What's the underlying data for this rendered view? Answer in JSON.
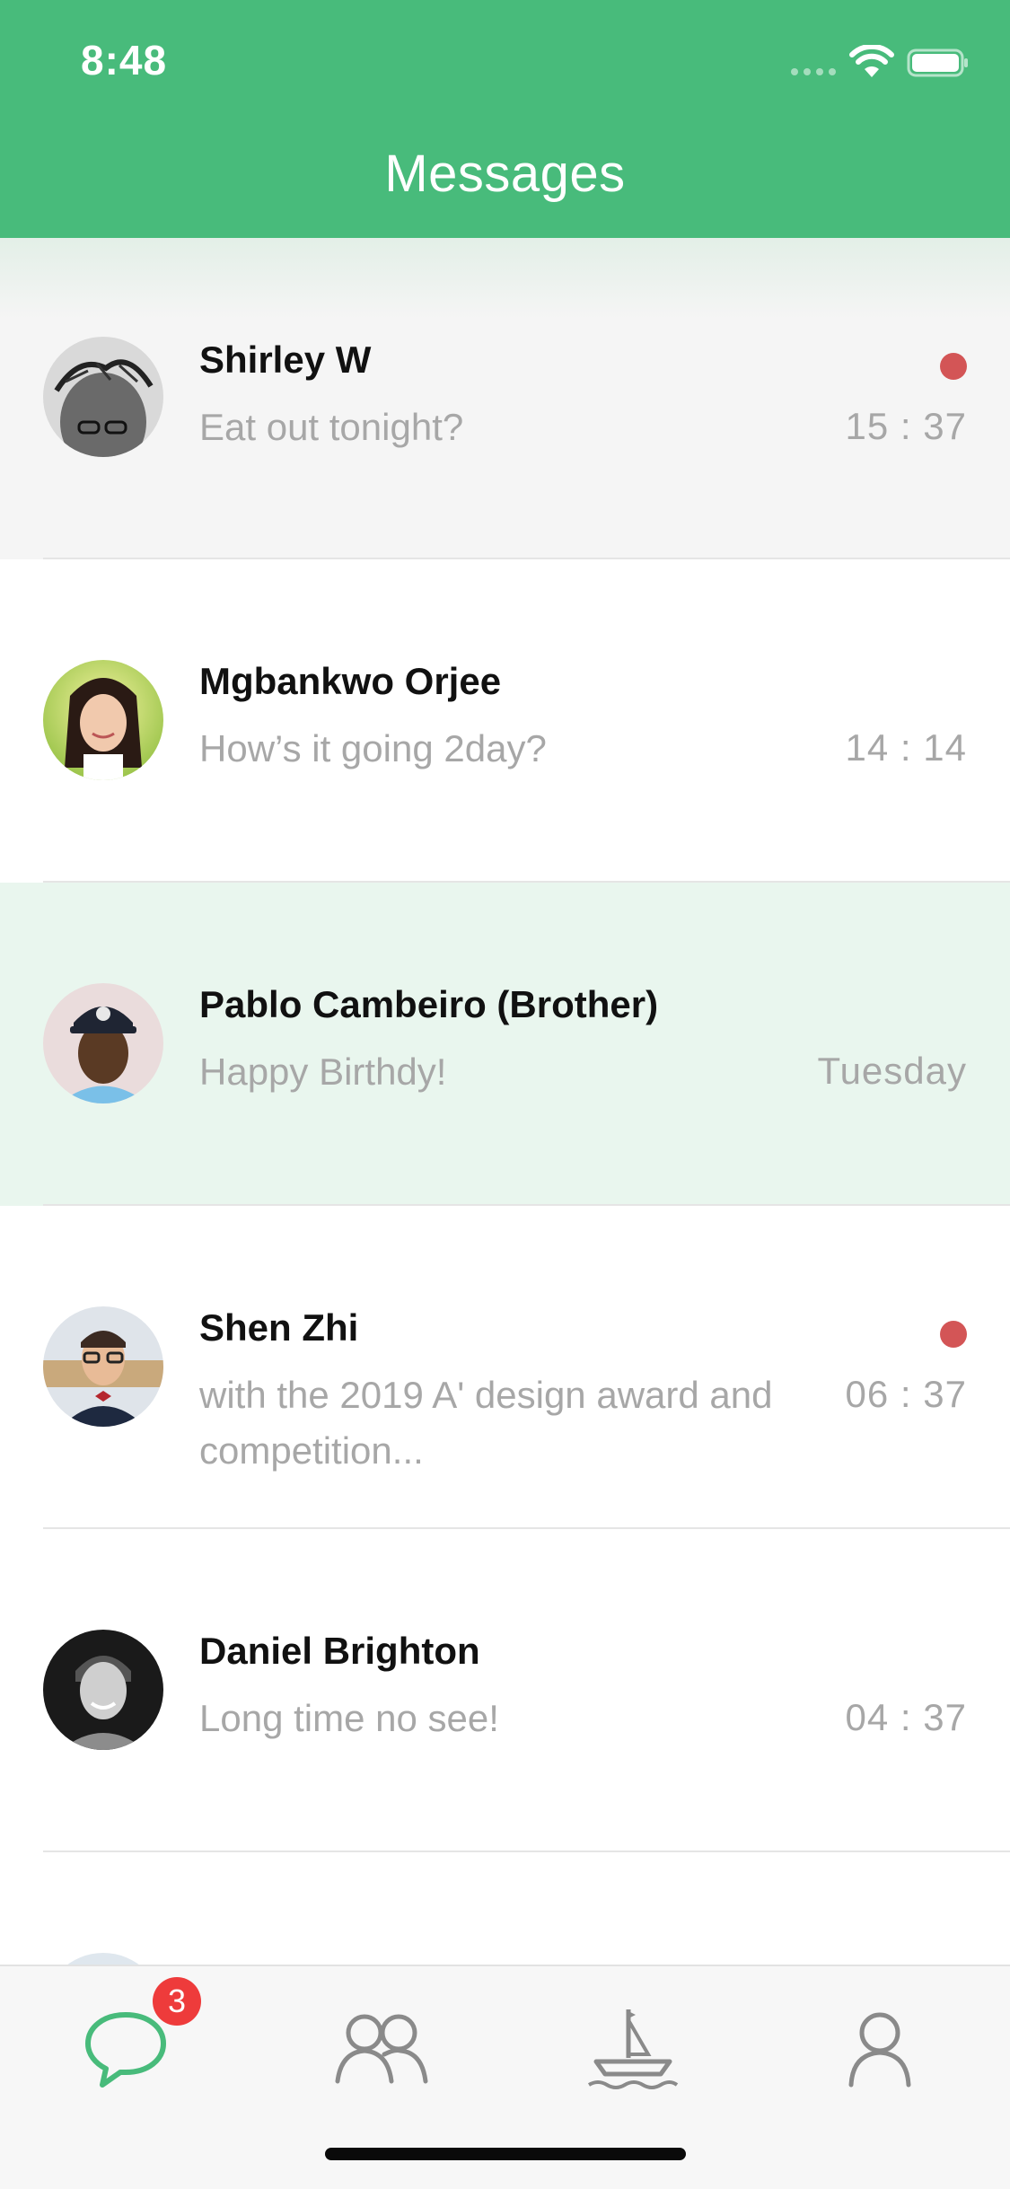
{
  "status_bar": {
    "time": "8:48"
  },
  "header": {
    "title": "Messages"
  },
  "conversations": [
    {
      "name": "Shirley W",
      "preview": "Eat out tonight?",
      "time": "15 : 37",
      "unread": true
    },
    {
      "name": "Mgbankwo Orjee",
      "preview": "How’s it going 2day?",
      "time": "14 : 14",
      "unread": false
    },
    {
      "name": "Pablo Cambeiro (Brother)",
      "preview": "Happy Birthdy!",
      "time": "Tuesday",
      "unread": false
    },
    {
      "name": "Shen Zhi",
      "preview": "with the 2019 A' design award and competition...",
      "time": "06 : 37",
      "unread": true
    },
    {
      "name": "Daniel Brighton",
      "preview": "Long time no see!",
      "time": "04 : 37",
      "unread": false
    }
  ],
  "tab_bar": {
    "tabs": [
      {
        "icon": "chat-bubble-icon",
        "active": true,
        "badge": "3"
      },
      {
        "icon": "contacts-icon",
        "active": false
      },
      {
        "icon": "sailboat-icon",
        "active": false
      },
      {
        "icon": "profile-icon",
        "active": false
      }
    ]
  },
  "colors": {
    "accent": "#48bb7b",
    "unread_dot": "#d35556",
    "badge": "#ee3b3b",
    "selected_row": "#e9f6ee"
  }
}
